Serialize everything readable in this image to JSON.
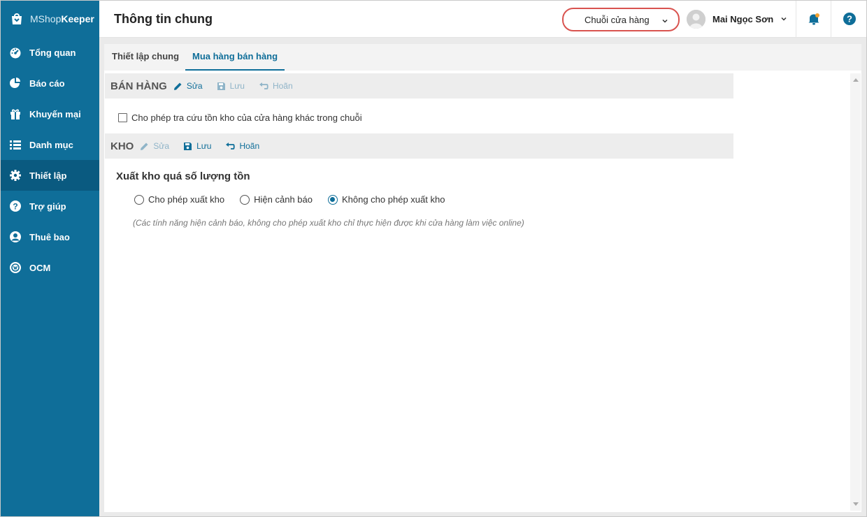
{
  "brand": {
    "prefix": "MShop",
    "suffix": "Keeper"
  },
  "sidebar": {
    "items": [
      {
        "label": "Tổng quan",
        "icon": "dashboard-icon"
      },
      {
        "label": "Báo cáo",
        "icon": "pie-chart-icon"
      },
      {
        "label": "Khuyến mại",
        "icon": "gift-icon"
      },
      {
        "label": "Danh mục",
        "icon": "list-icon"
      },
      {
        "label": "Thiết lập",
        "icon": "gear-icon",
        "active": true
      },
      {
        "label": "Trợ giúp",
        "icon": "question-icon"
      },
      {
        "label": "Thuê bao",
        "icon": "user-icon"
      },
      {
        "label": "OCM",
        "icon": "ocm-icon"
      }
    ]
  },
  "header": {
    "title": "Thông tin chung",
    "store_select": "Chuỗi cửa hàng",
    "user_name": "Mai Ngọc Sơn"
  },
  "tabs": [
    {
      "label": "Thiết lập chung",
      "active": false
    },
    {
      "label": "Mua hàng bán hàng",
      "active": true
    }
  ],
  "sales_section": {
    "title": "BÁN HÀNG",
    "edit": "Sửa",
    "save": "Lưu",
    "undo": "Hoãn",
    "checkbox_label": "Cho phép tra cứu tồn kho của cửa hàng khác trong chuỗi",
    "checked": false
  },
  "warehouse_section": {
    "title": "KHO",
    "edit": "Sửa",
    "save": "Lưu",
    "undo": "Hoãn",
    "heading": "Xuất kho quá số lượng tồn",
    "options": [
      "Cho phép xuất kho",
      "Hiện cảnh báo",
      "Không cho phép xuất kho"
    ],
    "selected_index": 2,
    "note": "(Các tính năng hiện cảnh báo, không cho phép xuất kho chỉ thực hiện được khi cửa hàng làm việc online)"
  },
  "colors": {
    "sidebar": "#0f6e99",
    "sidebar_active": "#0a5a80",
    "accent": "#0f6e99",
    "highlight_ring": "#d9534f",
    "notification_dot": "#f0a030"
  }
}
